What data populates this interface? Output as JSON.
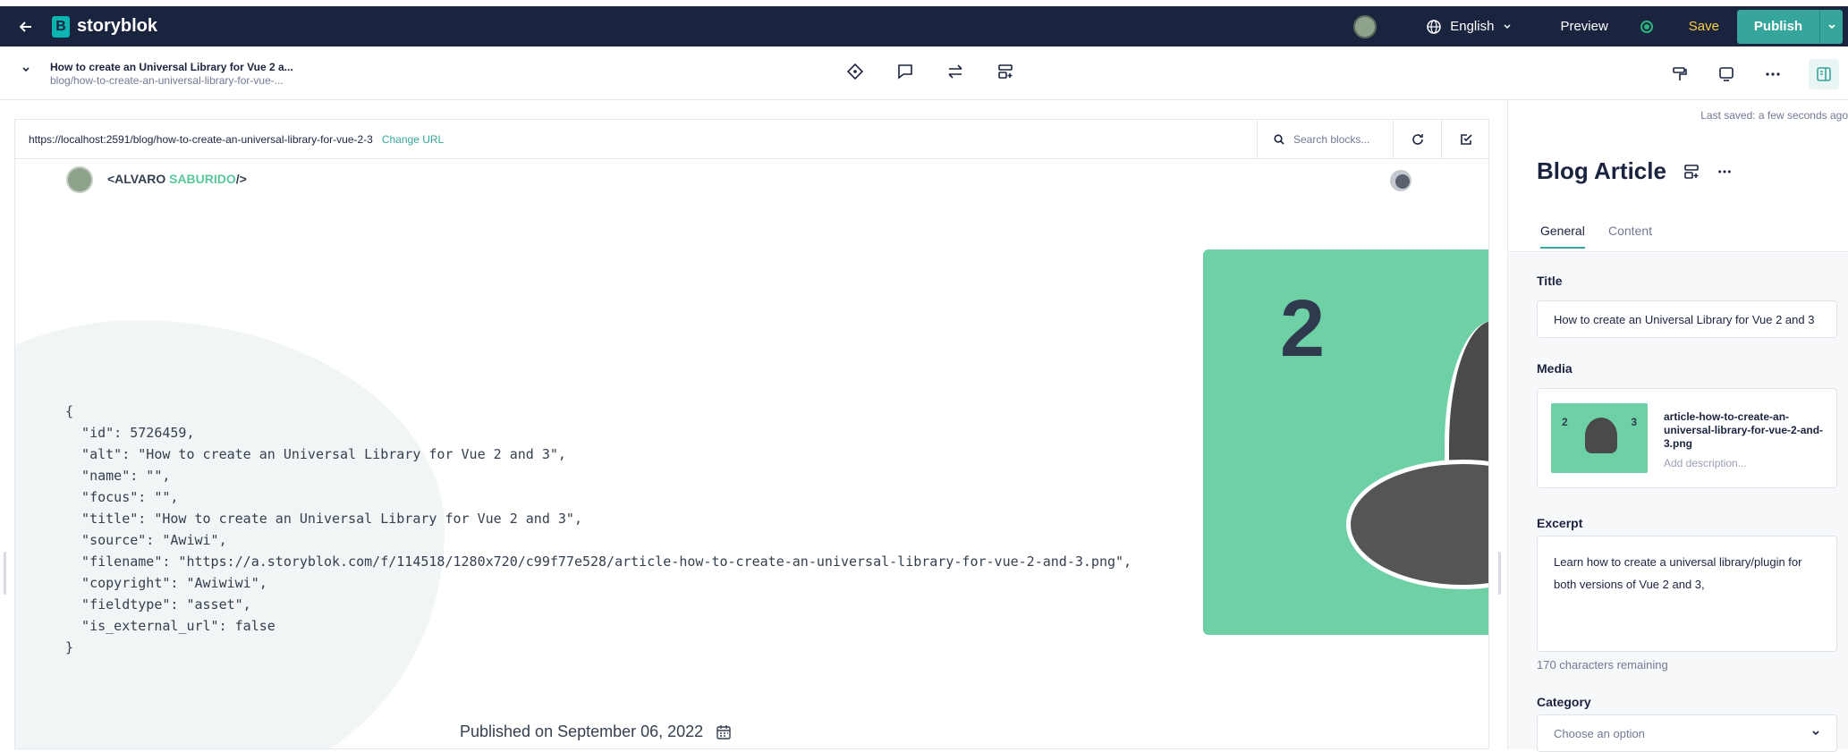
{
  "app": {
    "brand": "storyblok",
    "language": "English",
    "preview_label": "Preview",
    "save_label": "Save",
    "publish_label": "Publish"
  },
  "story": {
    "title": "How to create an Universal Library for Vue 2 a...",
    "slug": "blog/how-to-create-an-universal-library-for-vue-..."
  },
  "viewer": {
    "url": "https://localhost:2591/blog/how-to-create-an-universal-library-for-vue-2-3",
    "change_url_label": "Change URL",
    "search_placeholder": "Search blocks..."
  },
  "site": {
    "name_prefix": "<ALVARO ",
    "name_accent": "SABURIDO",
    "name_suffix": "/>",
    "json_lines": [
      "{",
      "  \"id\": 5726459,",
      "  \"alt\": \"How to create an Universal Library for Vue 2 and 3\",",
      "  \"name\": \"\",",
      "  \"focus\": \"\",",
      "  \"title\": \"How to create an Universal Library for Vue 2 and 3\",",
      "  \"source\": \"Awiwi\",",
      "  \"filename\": \"https://a.storyblok.com/f/114518/1280x720/c99f77e528/article-how-to-create-an-universal-library-for-vue-2-and-3.png\",",
      "  \"copyright\": \"Awiwiwi\",",
      "  \"fieldtype\": \"asset\",",
      "  \"is_external_url\": false",
      "}"
    ],
    "hero_number": "2",
    "published": "Published on September 06, 2022"
  },
  "panel": {
    "last_saved": "Last saved: a few seconds ago",
    "title": "Blog Article",
    "tabs": [
      {
        "label": "General",
        "active": true
      },
      {
        "label": "Content",
        "active": false
      }
    ],
    "fields": {
      "title_label": "Title",
      "title_value": "How to create an Universal Library for Vue 2 and 3",
      "media_label": "Media",
      "media_filename": "article-how-to-create-an-universal-library-for-vue-2-and-3.png",
      "media_thumb_left": "2",
      "media_thumb_right": "3",
      "media_description_placeholder": "Add description...",
      "excerpt_label": "Excerpt",
      "excerpt_value": "Learn how to create a universal library/plugin for both versions of Vue 2 and 3,",
      "excerpt_remaining": "170 characters remaining",
      "category_label": "Category",
      "category_placeholder": "Choose an option"
    }
  },
  "colors": {
    "topbar": "#1b243f",
    "accent": "#36a59b",
    "save": "#fbce41",
    "hero": "#6ed0a5"
  }
}
